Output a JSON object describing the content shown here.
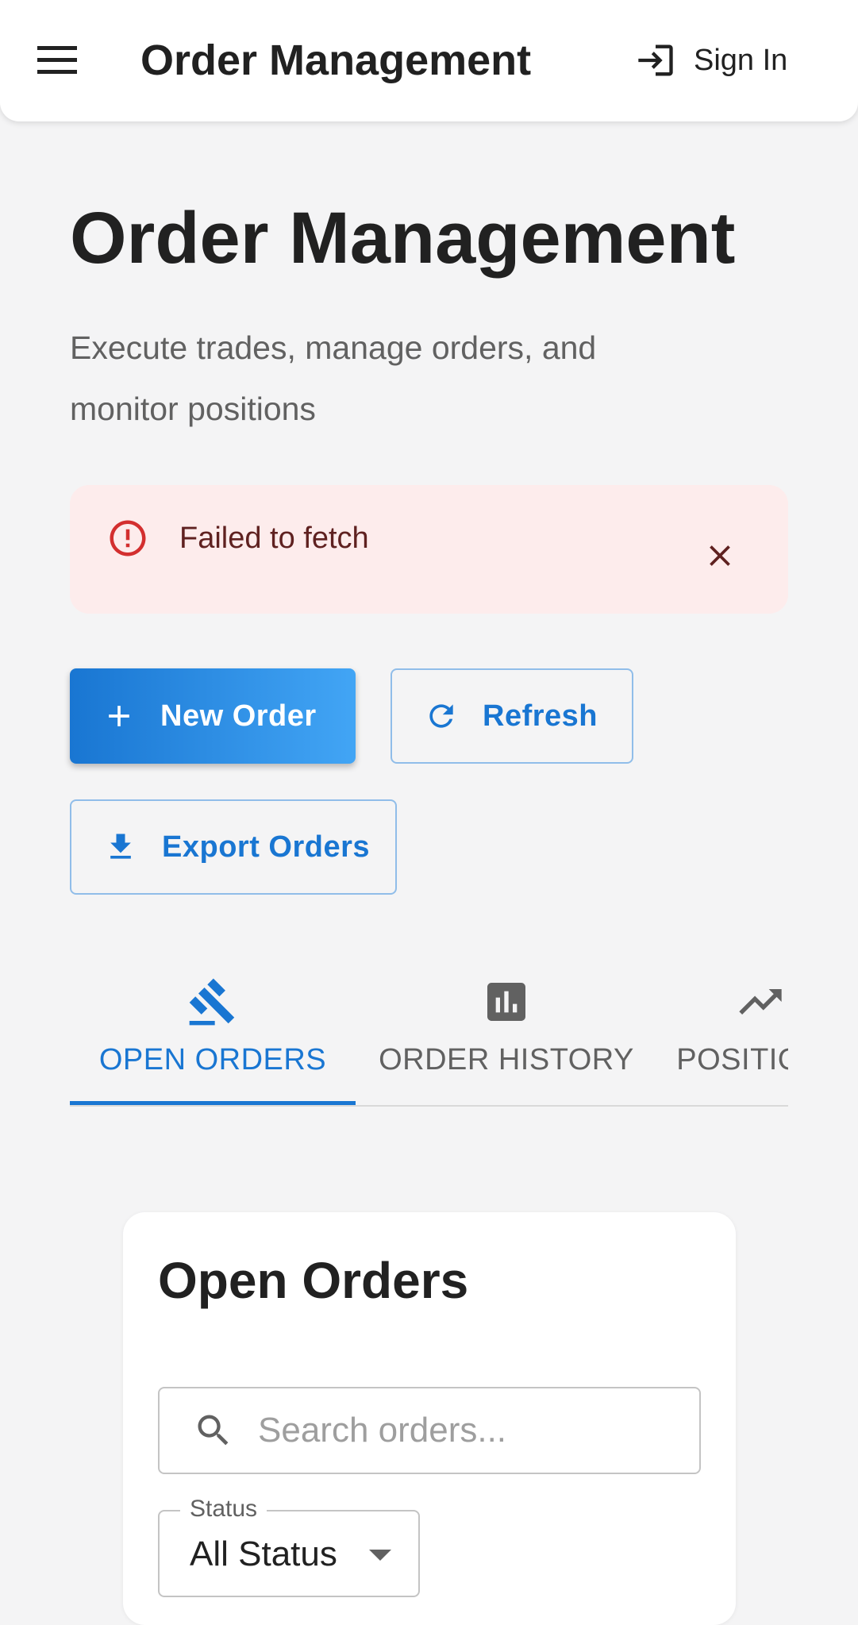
{
  "appbar": {
    "title": "Order Management",
    "sign_in_label": "Sign In"
  },
  "header": {
    "title": "Order Management",
    "subtitle": "Execute trades, manage orders, and monitor positions"
  },
  "alert": {
    "message": "Failed to fetch",
    "severity_color": "#d32f2f"
  },
  "actions": {
    "new_order_label": "New Order",
    "refresh_label": "Refresh",
    "export_label": "Export Orders"
  },
  "tabs": [
    {
      "label": "OPEN ORDERS",
      "icon": "gavel-icon",
      "active": true
    },
    {
      "label": "ORDER HISTORY",
      "icon": "bar-chart-icon",
      "active": false
    },
    {
      "label": "POSITIONS",
      "icon": "trending-icon",
      "active": false
    }
  ],
  "open_orders": {
    "title": "Open Orders",
    "search_placeholder": "Search orders...",
    "status_filter": {
      "label": "Status",
      "value": "All Status"
    }
  },
  "colors": {
    "primary": "#1976d2",
    "primary_light": "#42a5f5",
    "alert_bg": "#fdecec",
    "background": "#f4f4f5"
  }
}
